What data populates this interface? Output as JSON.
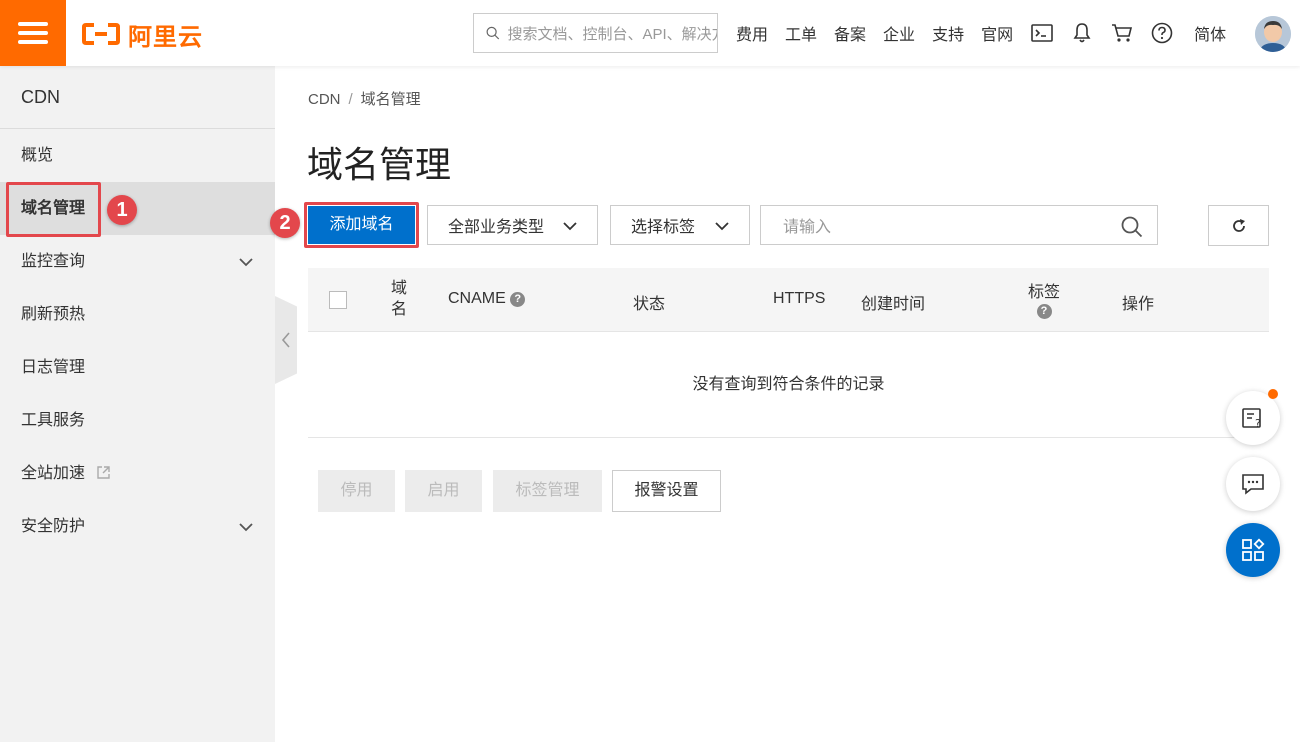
{
  "topbar": {
    "logo_text": "阿里云",
    "search_placeholder": "搜索文档、控制台、API、解决方案和资源",
    "nav": [
      "费用",
      "工单",
      "备案",
      "企业",
      "支持",
      "官网"
    ],
    "language": "简体",
    "brand_color": "#ff6a00"
  },
  "sidebar": {
    "title": "CDN",
    "items": [
      {
        "label": "概览"
      },
      {
        "label": "域名管理"
      },
      {
        "label": "监控查询"
      },
      {
        "label": "刷新预热"
      },
      {
        "label": "日志管理"
      },
      {
        "label": "工具服务"
      },
      {
        "label": "全站加速"
      },
      {
        "label": "安全防护"
      }
    ]
  },
  "annotations": {
    "step1": "1",
    "step2": "2",
    "highlight_color": "#e3474c"
  },
  "breadcrumb": {
    "root": "CDN",
    "sep": "/",
    "current": "域名管理"
  },
  "page_title": "域名管理",
  "toolbar": {
    "add_domain": "添加域名",
    "business_type": "全部业务类型",
    "select_tag": "选择标签",
    "search_placeholder": "请输入",
    "primary_color": "#0070cc"
  },
  "table": {
    "columns": {
      "domain": "域名",
      "cname": "CNAME",
      "status": "状态",
      "https": "HTTPS",
      "created": "创建时间",
      "tags": "标签",
      "actions": "操作"
    },
    "empty_text": "没有查询到符合条件的记录"
  },
  "batch_actions": {
    "disable": "停用",
    "enable": "启用",
    "tag_manage": "标签管理",
    "alert_settings": "报警设置"
  }
}
